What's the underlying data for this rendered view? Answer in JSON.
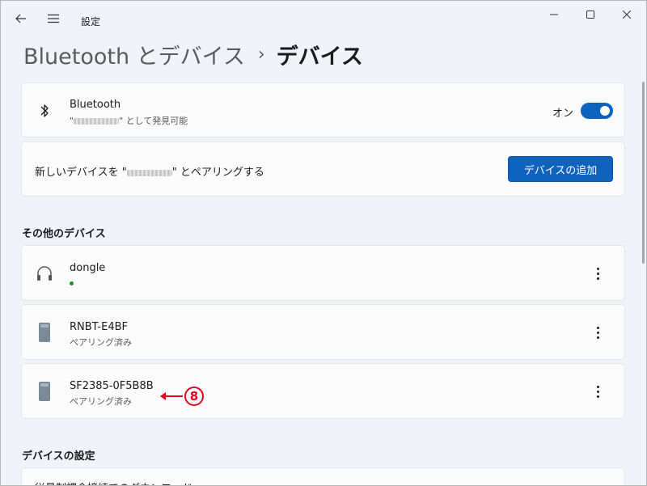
{
  "titlebar": {
    "app_title": "設定",
    "back_icon": "back-arrow-icon",
    "menu_icon": "hamburger-menu-icon"
  },
  "breadcrumb": {
    "parent": "Bluetooth とデバイス",
    "separator": "›",
    "current": "デバイス"
  },
  "bluetooth_card": {
    "title": "Bluetooth",
    "subtitle_prefix": "\"",
    "subtitle_suffix": "\" として発見可能",
    "toggle_label": "オン",
    "toggle_state": "on",
    "icon": "bluetooth-icon"
  },
  "pair_card": {
    "text_prefix": "新しいデバイスを \"",
    "text_suffix": "\" とペアリングする",
    "button_label": "デバイスの追加"
  },
  "other_devices": {
    "heading": "その他のデバイス",
    "items": [
      {
        "name": "dongle",
        "status": "connected",
        "icon": "headphones-icon"
      },
      {
        "name": "RNBT-E4BF",
        "status": "ペアリング済み",
        "icon": "generic-device-icon"
      },
      {
        "name": "SF2385-0F5B8B",
        "status": "ペアリング済み",
        "icon": "generic-device-icon"
      }
    ]
  },
  "annotation": {
    "number": "8",
    "color": "#e2001a"
  },
  "device_settings": {
    "heading": "デバイスの設定",
    "first_item": "従量制課金接続でのダウンロード"
  },
  "colors": {
    "accent": "#0f62be",
    "status_connected": "#1e8e3e"
  }
}
